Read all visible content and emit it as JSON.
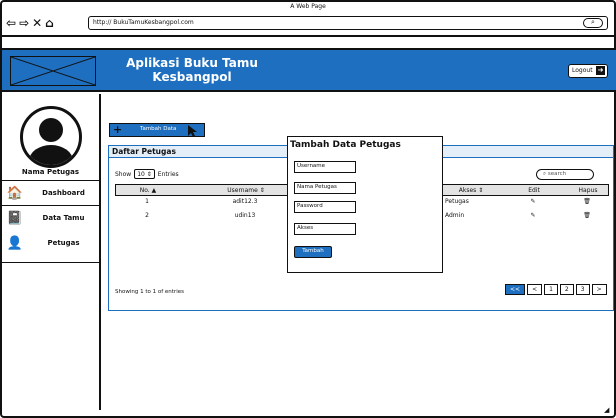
{
  "window": {
    "title": "A Web Page"
  },
  "browser": {
    "url": "http:// BukuTamuKesbangpol.com",
    "nav_icons": [
      "back-arrow-icon",
      "forward-arrow-icon",
      "close-icon",
      "home-icon"
    ],
    "search_icon": "search-icon"
  },
  "header": {
    "title_line1": "Aplikasi Buku Tamu",
    "title_line2": "Kesbangpol",
    "logout_label": "Logout",
    "accent_color": "#1e6fbf"
  },
  "sidebar": {
    "user_name": "Nama Petugas",
    "items": [
      {
        "label": "Dashboard",
        "icon": "home-icon"
      },
      {
        "label": "Data Tamu",
        "icon": "book-icon"
      },
      {
        "label": "Petugas",
        "icon": "add-user-icon"
      }
    ]
  },
  "main": {
    "add_button": "Tambah Data",
    "panel_title": "Daftar Petugas",
    "show_label": "Show",
    "show_value": "10",
    "entries_label": "Entries",
    "search_placeholder": "search",
    "columns": [
      "No.",
      "Username",
      "Akses",
      "Edit",
      "Hapus"
    ],
    "rows": [
      {
        "no": "1",
        "username": "adit12.3",
        "akses": "Petugas"
      },
      {
        "no": "2",
        "username": "udin13",
        "akses": "Admin"
      }
    ],
    "showing_text": "Showing 1 to 1 of entries",
    "pagination": [
      "<<",
      "<",
      "1",
      "2",
      "3",
      ">"
    ]
  },
  "modal": {
    "title": "Tambah Data Petugas",
    "fields": [
      "Username",
      "Nama Petugas",
      "Password",
      "Akses"
    ],
    "submit_label": "Tambah"
  }
}
